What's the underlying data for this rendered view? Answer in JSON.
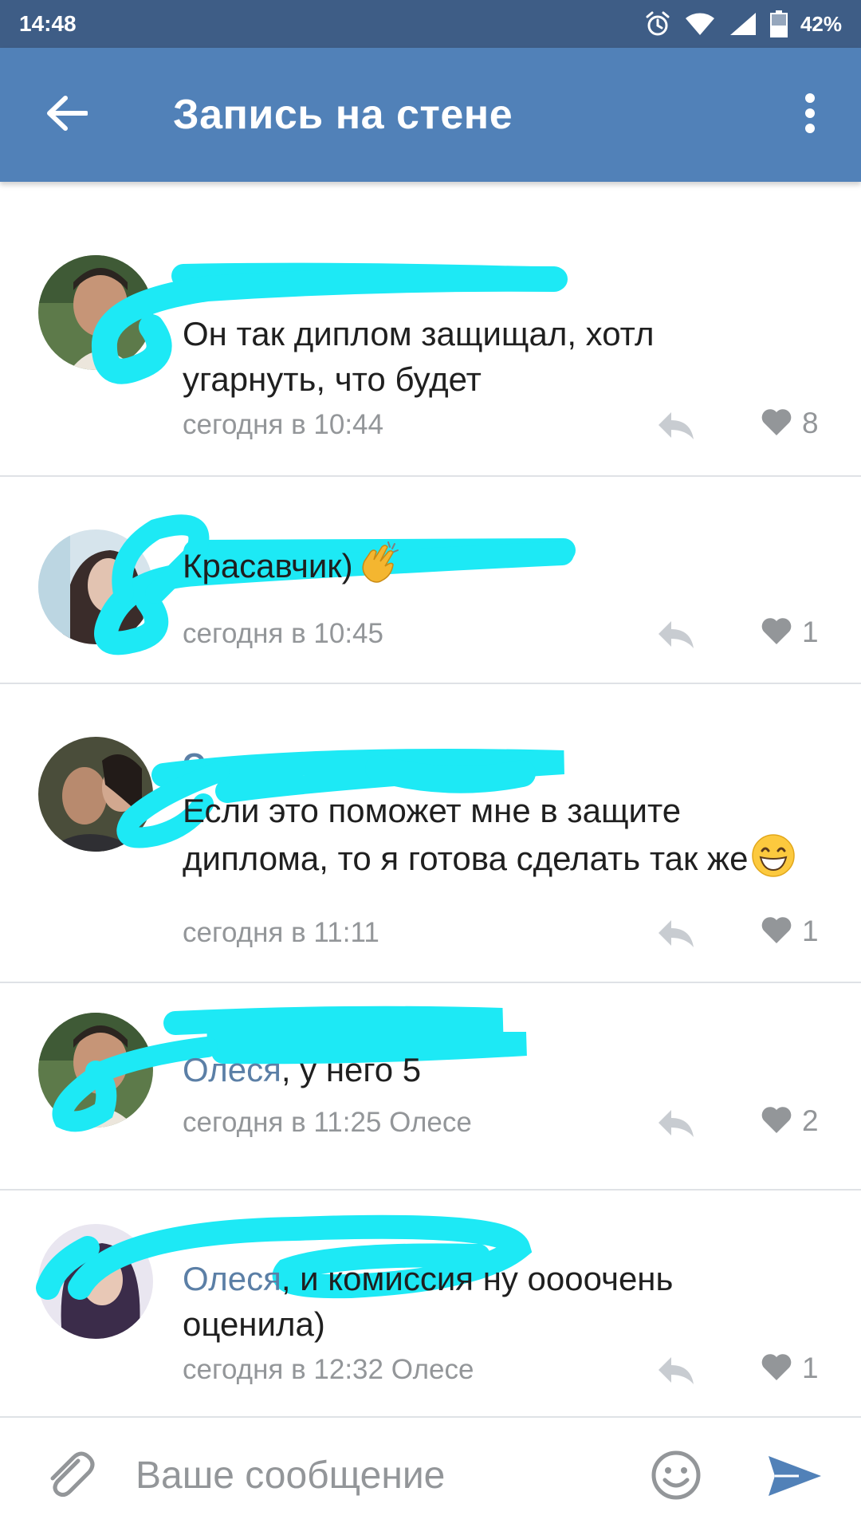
{
  "status_bar": {
    "time": "14:48",
    "battery": "42%",
    "icons": [
      "alarm-icon",
      "wifi-icon",
      "signal-icon",
      "battery-icon"
    ]
  },
  "toolbar": {
    "title": "Запись на стене",
    "back_icon": "arrow-left-icon",
    "more_icon": "more-vertical-icon"
  },
  "colors": {
    "toolbar": "#5181b8",
    "status_bar": "#3e5d86",
    "link": "#5b7fa6",
    "muted": "#939699",
    "scribble": "#1de9f5"
  },
  "comments": [
    {
      "text": "Он так диплом защищал, хотл угарнуть, что будет",
      "time": "сегодня в 10:44",
      "likes": "8"
    },
    {
      "text": "Красавчик)",
      "emoji": "clapping-hands-emoji",
      "time": "сегодня в 10:45",
      "likes": "1"
    },
    {
      "author_partial": "Олес",
      "text": "Если это поможет мне в защите диплома, то я готова сделать так же",
      "emoji": "grinning-face-emoji",
      "time": "сегодня в 11:11",
      "likes": "1"
    },
    {
      "mention": "Олеся",
      "text": ", у него 5",
      "time": "сегодня в 11:25",
      "reply_to": "Олесе",
      "likes": "2"
    },
    {
      "mention": "Олеся",
      "text": ", и комиссия ну оооочень оценила)",
      "time": "сегодня в 12:32",
      "reply_to": "Олесе",
      "likes": "1"
    }
  ],
  "input": {
    "placeholder": "Ваше сообщение",
    "attach_icon": "paperclip-icon",
    "emoji_icon": "smiley-icon",
    "send_icon": "send-icon"
  }
}
